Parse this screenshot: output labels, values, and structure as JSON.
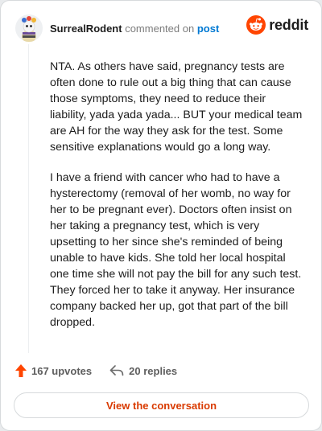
{
  "header": {
    "username": "SurrealRodent",
    "action_text": "commented on",
    "post_link": "post",
    "brand_name": "reddit"
  },
  "comment": {
    "paragraphs": [
      "NTA. As others have said, pregnancy tests are often done to rule out a big thing that can cause those symptoms, they need to reduce their liability, yada yada yada... BUT your medical team are AH for the way they ask for the test. Some sensitive explanations would go a long way.",
      "I have a friend with cancer who had to have a hysterectomy (removal of her womb, no way for her to be pregnant ever). Doctors often insist on her taking a pregnancy test, which is very upsetting to her since she's reminded of being unable to have kids. She told her local hospital one time she will not pay the bill for any such test. They forced her to take it anyway. Her insurance company backed her up, got that part of the bill dropped."
    ]
  },
  "actions": {
    "upvotes": "167 upvotes",
    "replies": "20 replies"
  },
  "cta": {
    "label": "View the conversation"
  },
  "colors": {
    "brand": "#ff4500",
    "link": "#0079d3",
    "cta_text": "#d93a00"
  },
  "icons": {
    "brand": "reddit-snoo-icon",
    "upvote": "upvote-arrow-icon",
    "reply": "reply-arrow-icon"
  }
}
